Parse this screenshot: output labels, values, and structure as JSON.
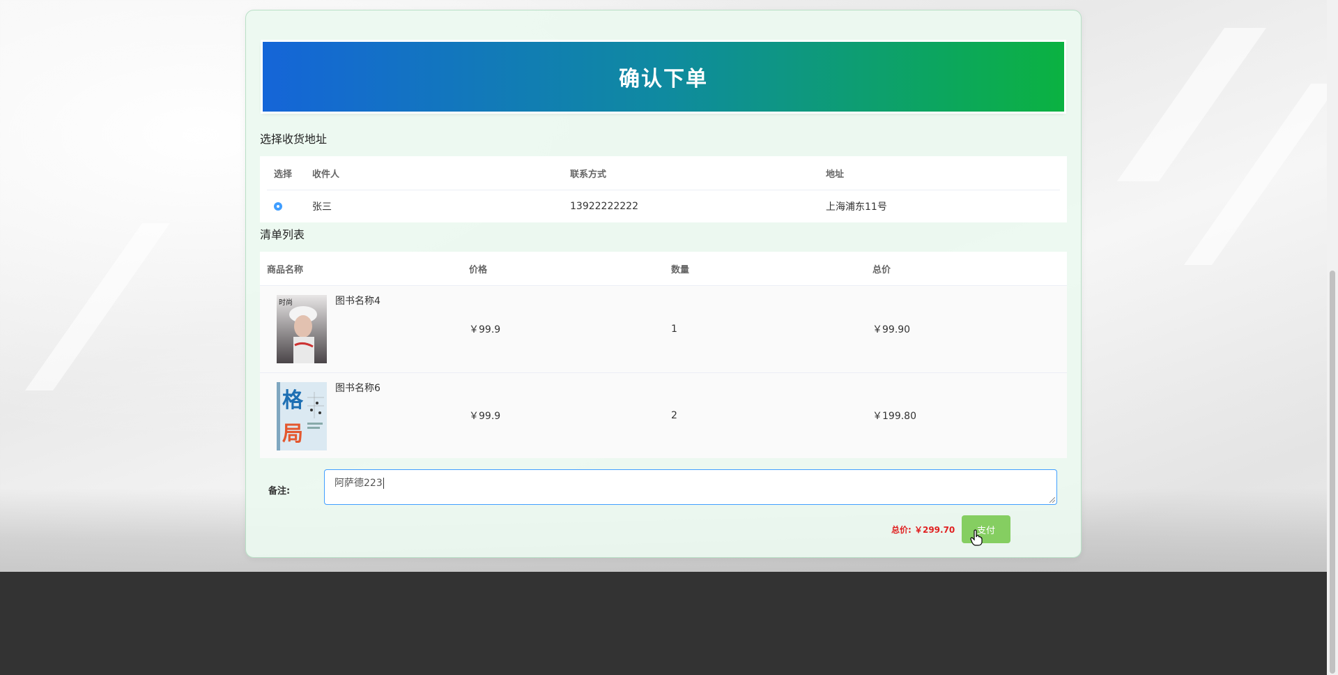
{
  "banner": {
    "title": "确认下单"
  },
  "address_section": {
    "title": "选择收货地址",
    "columns": [
      "选择",
      "收件人",
      "联系方式",
      "地址"
    ],
    "rows": [
      {
        "selected": true,
        "name": "张三",
        "phone": "13922222222",
        "address": "上海浦东11号"
      }
    ]
  },
  "order_section": {
    "title": "清单列表",
    "columns": [
      "商品名称",
      "价格",
      "数量",
      "总价"
    ],
    "items": [
      {
        "name": "图书名称4",
        "price": "￥99.9",
        "quantity": "1",
        "subtotal": "￥99.90",
        "cover": "fashion-magazine-cover"
      },
      {
        "name": "图书名称6",
        "price": "￥99.9",
        "quantity": "2",
        "subtotal": "￥199.80",
        "cover": "book-cover-格局"
      }
    ]
  },
  "remark": {
    "label": "备注:",
    "value": "阿萨德223"
  },
  "summary": {
    "total_label": "总价: ￥299.70",
    "pay_label": "支付"
  },
  "colors": {
    "accent": "#409eff",
    "pay_button": "#85ce61",
    "total": "#e02020",
    "footer": "#333333"
  }
}
